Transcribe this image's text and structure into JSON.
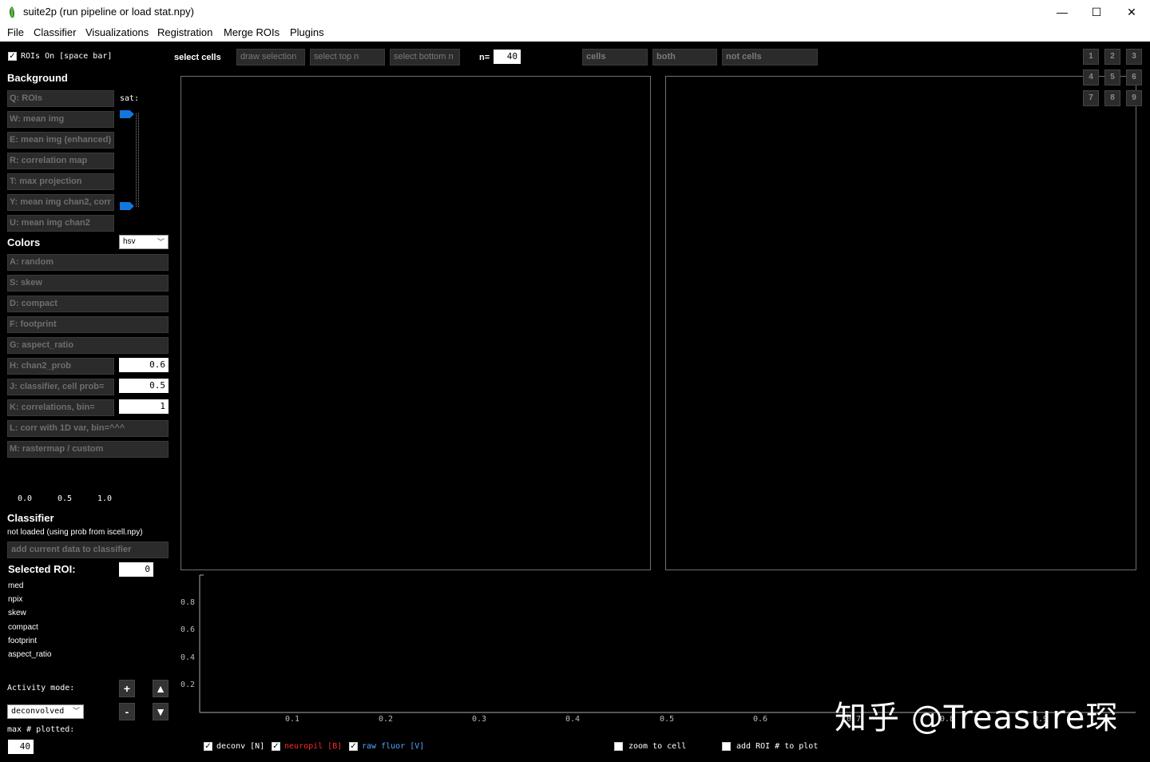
{
  "window": {
    "title": "suite2p (run pipeline or load stat.npy)",
    "minimize": "—",
    "maximize": "☐",
    "close": "✕"
  },
  "menu": [
    "File",
    "Classifier",
    "Visualizations",
    "Registration",
    "Merge ROIs",
    "Plugins"
  ],
  "rois_toggle": {
    "checked": true,
    "label": "ROIs On [space bar]"
  },
  "background": {
    "heading": "Background",
    "sat_label": "sat:",
    "buttons": [
      "Q: ROIs",
      "W: mean img",
      "E: mean img (enhanced)",
      "R: correlation map",
      "T: max projection",
      "Y: mean img chan2, corr",
      "U: mean img chan2"
    ]
  },
  "colors": {
    "heading": "Colors",
    "colormap": "hsv",
    "buttons": [
      "A: random",
      "S: skew",
      "D: compact",
      "F: footprint",
      "G: aspect_ratio",
      "H: chan2_prob",
      "J: classifier, cell prob=",
      "K: correlations, bin=",
      "L: corr with 1D var, bin=^^^",
      "M: rastermap / custom"
    ],
    "chan2_prob_value": "0.6",
    "cell_prob_value": "0.5",
    "bin_value": "1",
    "colorbar_ticks": [
      "0.0",
      "0.5",
      "1.0"
    ]
  },
  "classifier": {
    "heading": "Classifier",
    "status": "not loaded (using prob from iscell.npy)",
    "add_button": "add current data to classifier"
  },
  "selected_roi": {
    "heading": "Selected ROI:",
    "value": "0",
    "stats": [
      "med",
      "npix",
      "skew",
      "compact",
      "footprint",
      "aspect_ratio"
    ]
  },
  "activity": {
    "label": "Activity mode:",
    "mode": "deconvolved",
    "plus": "+",
    "minus": "-",
    "up": "▲",
    "down": "▼",
    "max_plotted_label": "max # plotted:",
    "max_plotted_value": "40"
  },
  "toolbar": {
    "select_cells": "select cells",
    "draw_selection": "draw selection",
    "select_top": "select top n",
    "select_bottom": "select bottom n",
    "n_label": "n=",
    "n_value": "40",
    "cells": "cells",
    "both": "both",
    "not_cells": "not cells"
  },
  "view_buttons": [
    "1",
    "2",
    "3",
    "4",
    "5",
    "6",
    "7",
    "8",
    "9"
  ],
  "trace_plot": {
    "y_ticks": [
      "0.8",
      "0.6",
      "0.4",
      "0.2"
    ],
    "x_ticks": [
      "0.1",
      "0.2",
      "0.3",
      "0.4",
      "0.5",
      "0.6",
      "0.7",
      "0.8",
      "0.9"
    ]
  },
  "trace_options": [
    {
      "label": "deconv [N]",
      "checked": true,
      "color": "#ffffff"
    },
    {
      "label": "neuropil [B]",
      "checked": true,
      "color": "#ff2a2a"
    },
    {
      "label": "raw fluor [V]",
      "checked": true,
      "color": "#4ea9ff"
    },
    {
      "label": "zoom to cell",
      "checked": false,
      "color": "#ffffff"
    },
    {
      "label": "add ROI # to plot",
      "checked": false,
      "color": "#ffffff"
    }
  ],
  "watermark": "知乎 @Treasure琛"
}
